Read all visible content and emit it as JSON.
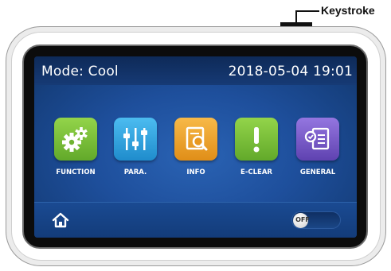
{
  "callout": {
    "label": "Keystroke"
  },
  "status": {
    "mode": "Mode: Cool",
    "datetime": "2018-05-04 19:01"
  },
  "menu": [
    {
      "label": "FUNCTION",
      "icon": "gears-icon",
      "color": "#7cc23a"
    },
    {
      "label": "PARA.",
      "icon": "sliders-icon",
      "color": "#33a6e0"
    },
    {
      "label": "INFO",
      "icon": "document-search-icon",
      "color": "#f0a52c"
    },
    {
      "label": "E-CLEAR",
      "icon": "exclamation-icon",
      "color": "#7cc23a"
    },
    {
      "label": "GENERAL",
      "icon": "general-settings-icon",
      "color": "#7a5cc8"
    }
  ],
  "bottom": {
    "home_icon": "home-icon",
    "toggle_text": "OFF"
  }
}
